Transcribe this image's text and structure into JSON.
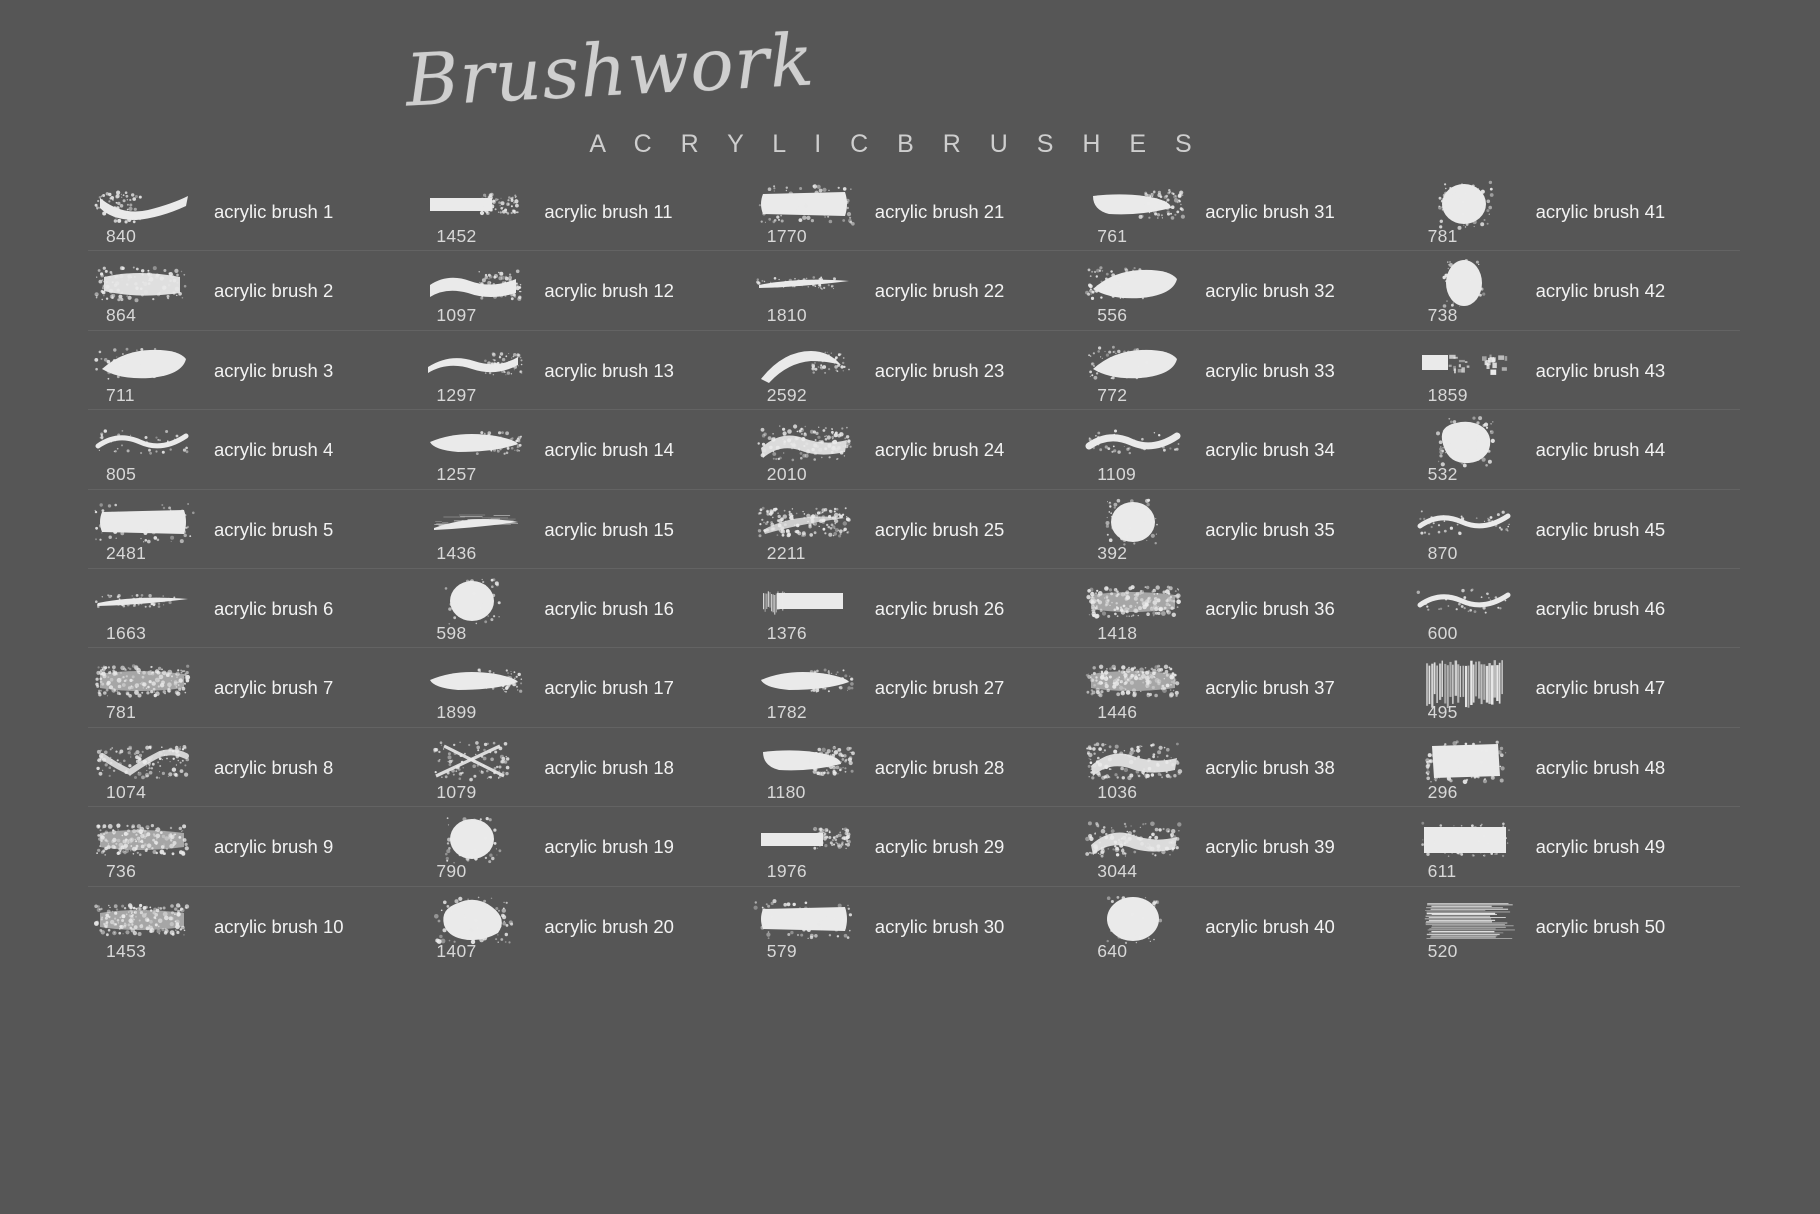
{
  "header": {
    "script_title": "Brushwork",
    "sub_title": "A C R Y L I C   B R U S H E S"
  },
  "palette": {
    "background": "#565656",
    "label_text": "#f2f2f2",
    "number_text": "#d8d8d8",
    "title_text": "#cfcfcf",
    "divider": "#636363",
    "brush_ink": "#eaeaea"
  },
  "columns": [
    {
      "index": 1,
      "brushes": [
        {
          "label": "acrylic brush 1",
          "number": "840",
          "shape": "tapered-curve-stroke"
        },
        {
          "label": "acrylic brush 2",
          "number": "864",
          "shape": "speckled-flat-stroke"
        },
        {
          "label": "acrylic brush 3",
          "number": "711",
          "shape": "thick-wedge-stroke"
        },
        {
          "label": "acrylic brush 4",
          "number": "805",
          "shape": "soft-wave-stroke"
        },
        {
          "label": "acrylic brush 5",
          "number": "2481",
          "shape": "solid-block-stroke"
        },
        {
          "label": "acrylic brush 6",
          "number": "1663",
          "shape": "thin-sliver-stroke"
        },
        {
          "label": "acrylic brush 7",
          "number": "781",
          "shape": "dry-textured-stroke"
        },
        {
          "label": "acrylic brush 8",
          "number": "1074",
          "shape": "broken-zigzag-stroke"
        },
        {
          "label": "acrylic brush 9",
          "number": "736",
          "shape": "grainy-fan-stroke"
        },
        {
          "label": "acrylic brush 10",
          "number": "1453",
          "shape": "rough-slab-stroke"
        }
      ]
    },
    {
      "index": 2,
      "brushes": [
        {
          "label": "acrylic brush 11",
          "number": "1452",
          "shape": "flat-bar-stroke"
        },
        {
          "label": "acrylic brush 12",
          "number": "1097",
          "shape": "chunky-ribbon-stroke"
        },
        {
          "label": "acrylic brush 13",
          "number": "1297",
          "shape": "s-curve-stroke"
        },
        {
          "label": "acrylic brush 14",
          "number": "1257",
          "shape": "pointed-taper-stroke"
        },
        {
          "label": "acrylic brush 15",
          "number": "1436",
          "shape": "feathered-blade-stroke"
        },
        {
          "label": "acrylic brush 16",
          "number": "598",
          "shape": "round-blob"
        },
        {
          "label": "acrylic brush 17",
          "number": "1899",
          "shape": "smooth-lozenge-stroke"
        },
        {
          "label": "acrylic brush 18",
          "number": "1079",
          "shape": "cross-hatch-stroke"
        },
        {
          "label": "acrylic brush 19",
          "number": "790",
          "shape": "round-dab"
        },
        {
          "label": "acrylic brush 20",
          "number": "1407",
          "shape": "splat-blob"
        }
      ]
    },
    {
      "index": 3,
      "brushes": [
        {
          "label": "acrylic brush 21",
          "number": "1770",
          "shape": "wide-slab-stroke"
        },
        {
          "label": "acrylic brush 22",
          "number": "1810",
          "shape": "thin-blur-stroke"
        },
        {
          "label": "acrylic brush 23",
          "number": "2592",
          "shape": "arc-hook-stroke"
        },
        {
          "label": "acrylic brush 24",
          "number": "2010",
          "shape": "wing-streak-stroke"
        },
        {
          "label": "acrylic brush 25",
          "number": "2211",
          "shape": "speckled-arc-stroke"
        },
        {
          "label": "acrylic brush 26",
          "number": "1376",
          "shape": "comb-edge-stroke"
        },
        {
          "label": "acrylic brush 27",
          "number": "1782",
          "shape": "oval-smear"
        },
        {
          "label": "acrylic brush 28",
          "number": "1180",
          "shape": "fading-slab-stroke"
        },
        {
          "label": "acrylic brush 29",
          "number": "1976",
          "shape": "tapered-bar-stroke"
        },
        {
          "label": "acrylic brush 30",
          "number": "579",
          "shape": "stubby-block-stroke"
        }
      ]
    },
    {
      "index": 4,
      "brushes": [
        {
          "label": "acrylic brush 31",
          "number": "761",
          "shape": "ragged-chunk-stroke"
        },
        {
          "label": "acrylic brush 32",
          "number": "556",
          "shape": "broad-patch-stroke"
        },
        {
          "label": "acrylic brush 33",
          "number": "772",
          "shape": "rounded-slab-stroke"
        },
        {
          "label": "acrylic brush 34",
          "number": "1109",
          "shape": "ribbon-wave-stroke"
        },
        {
          "label": "acrylic brush 35",
          "number": "392",
          "shape": "round-blob"
        },
        {
          "label": "acrylic brush 36",
          "number": "1418",
          "shape": "gritty-bar-stroke"
        },
        {
          "label": "acrylic brush 37",
          "number": "1446",
          "shape": "scratchy-bar-stroke"
        },
        {
          "label": "acrylic brush 38",
          "number": "1036",
          "shape": "curl-blob-stroke"
        },
        {
          "label": "acrylic brush 39",
          "number": "3044",
          "shape": "angled-sweep-stroke"
        },
        {
          "label": "acrylic brush 40",
          "number": "640",
          "shape": "big-round-blob"
        }
      ]
    },
    {
      "index": 5,
      "brushes": [
        {
          "label": "acrylic brush 41",
          "number": "781",
          "shape": "round-blob"
        },
        {
          "label": "acrylic brush 42",
          "number": "738",
          "shape": "tall-oval-blob"
        },
        {
          "label": "acrylic brush 43",
          "number": "1859",
          "shape": "dashed-bar-stroke"
        },
        {
          "label": "acrylic brush 44",
          "number": "532",
          "shape": "irregular-blob"
        },
        {
          "label": "acrylic brush 45",
          "number": "870",
          "shape": "thin-wave-stroke"
        },
        {
          "label": "acrylic brush 46",
          "number": "600",
          "shape": "soft-wave-stroke"
        },
        {
          "label": "acrylic brush 47",
          "number": "495",
          "shape": "vertical-hatch-block"
        },
        {
          "label": "acrylic brush 48",
          "number": "296",
          "shape": "dense-square-blob"
        },
        {
          "label": "acrylic brush 49",
          "number": "611",
          "shape": "solid-rect-stroke"
        },
        {
          "label": "acrylic brush 50",
          "number": "520",
          "shape": "fine-line-hatch"
        }
      ]
    }
  ]
}
